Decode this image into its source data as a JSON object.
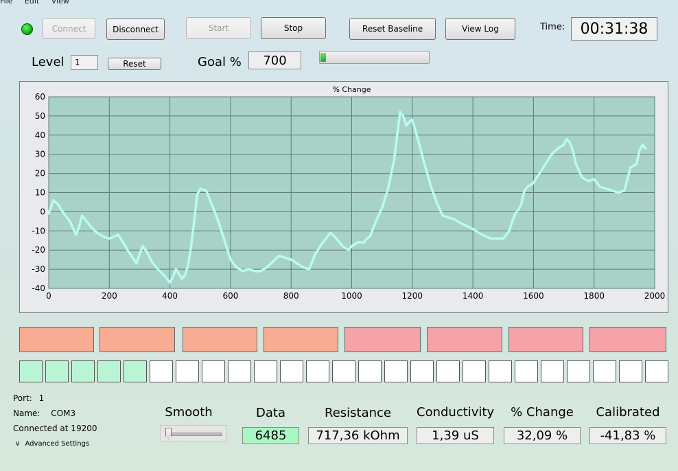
{
  "menu": [
    "File",
    "Edit",
    "View"
  ],
  "toolbar": {
    "connect": "Connect",
    "disconnect": "Disconnect",
    "start": "Start",
    "stop": "Stop",
    "reset_baseline": "Reset Baseline",
    "view_log": "View Log",
    "time_label": "Time:",
    "time_value": "00:31:38",
    "status_color": "#1fc21f"
  },
  "level": {
    "label": "Level",
    "value": "1",
    "reset": "Reset"
  },
  "goal": {
    "label": "Goal %",
    "value": "700",
    "progress": 0.05
  },
  "chart_data": {
    "type": "line",
    "title": "% Change",
    "xlim": [
      0,
      2000
    ],
    "ylim": [
      -40,
      60
    ],
    "xticks": [
      0,
      200,
      400,
      600,
      800,
      1000,
      1200,
      1400,
      1600,
      1800,
      2000
    ],
    "yticks": [
      60,
      50,
      40,
      30,
      20,
      10,
      0,
      -10,
      -20,
      -30,
      -40
    ],
    "grid": true,
    "background_color": "#a8d2c8",
    "line_color": "#b8fbf1",
    "series": [
      {
        "x": [
          0,
          15,
          30,
          50,
          70,
          90,
          100,
          110,
          120,
          140,
          160,
          180,
          200,
          230,
          260,
          290,
          300,
          310,
          320,
          340,
          360,
          380,
          400,
          410,
          420,
          440,
          450,
          460,
          470,
          480,
          490,
          500,
          520,
          540,
          560,
          580,
          600,
          620,
          640,
          660,
          680,
          700,
          720,
          740,
          760,
          780,
          800,
          820,
          840,
          860,
          870,
          880,
          900,
          930,
          950,
          970,
          990,
          1000,
          1020,
          1040,
          1050,
          1060,
          1080,
          1100,
          1120,
          1140,
          1150,
          1160,
          1170,
          1180,
          1190,
          1200,
          1220,
          1240,
          1260,
          1280,
          1300,
          1320,
          1340,
          1360,
          1400,
          1430,
          1460,
          1480,
          1500,
          1520,
          1530,
          1540,
          1550,
          1560,
          1570,
          1580,
          1600,
          1620,
          1640,
          1660,
          1680,
          1700,
          1710,
          1720,
          1730,
          1740,
          1760,
          1780,
          1800,
          1820,
          1840,
          1860,
          1880,
          1900,
          1920,
          1930,
          1940,
          1950,
          1960,
          1970
        ],
        "y": [
          -1,
          6,
          4,
          -1,
          -5,
          -12,
          -8,
          -2,
          -4,
          -8,
          -11,
          -13,
          -14,
          -12,
          -20,
          -27,
          -22,
          -18,
          -20,
          -26,
          -30,
          -33,
          -37,
          -34,
          -30,
          -35,
          -33,
          -28,
          -18,
          -5,
          9,
          12,
          11,
          3,
          -5,
          -15,
          -25,
          -29,
          -31,
          -30,
          -31,
          -31,
          -29,
          -26,
          -23,
          -24,
          -25,
          -27,
          -29,
          -30,
          -26,
          -22,
          -17,
          -11,
          -14,
          -18,
          -20,
          -18,
          -16,
          -16,
          -14,
          -13,
          -5,
          2,
          12,
          27,
          40,
          52,
          50,
          45,
          47,
          48,
          37,
          25,
          14,
          5,
          -2,
          -3,
          -4,
          -6,
          -9,
          -12,
          -14,
          -14,
          -14,
          -10,
          -5,
          -1,
          1,
          4,
          11,
          13,
          15,
          20,
          25,
          30,
          33,
          35,
          38,
          36,
          32,
          25,
          18,
          16,
          17,
          13,
          12,
          11,
          10,
          11,
          23,
          24,
          25,
          32,
          35,
          33
        ]
      }
    ]
  },
  "blocks_large": [
    {
      "color": "#f8ac94"
    },
    {
      "color": "#f8ac94"
    },
    {
      "color": "#f8ac94"
    },
    {
      "color": "#f8ac94"
    },
    {
      "color": "#f5a2a8"
    },
    {
      "color": "#f5a2a8"
    },
    {
      "color": "#f5a2a8"
    },
    {
      "color": "#f5a2a8"
    }
  ],
  "blocks_small": {
    "total": 25,
    "filled": 5,
    "fill_color": "#b8f5d2",
    "empty_color": "#ffffff"
  },
  "port": {
    "port_label": "Port:",
    "port_value": "1",
    "name_label": "Name:",
    "name_value": "COM3",
    "connected_text": "Connected at 19200",
    "advanced": "Advanced Settings"
  },
  "smooth": {
    "label": "Smooth",
    "value": 0
  },
  "readouts": {
    "data_label": "Data",
    "data_value": "6485",
    "data_color": "#aaf7c4",
    "resistance_label": "Resistance",
    "resistance_value": "717,36 kOhm",
    "conductivity_label": "Conductivity",
    "conductivity_value": "1,39 uS",
    "change_label": "% Change",
    "change_value": "32,09 %",
    "calibrated_label": "Calibrated",
    "calibrated_value": "-41,83 %"
  }
}
